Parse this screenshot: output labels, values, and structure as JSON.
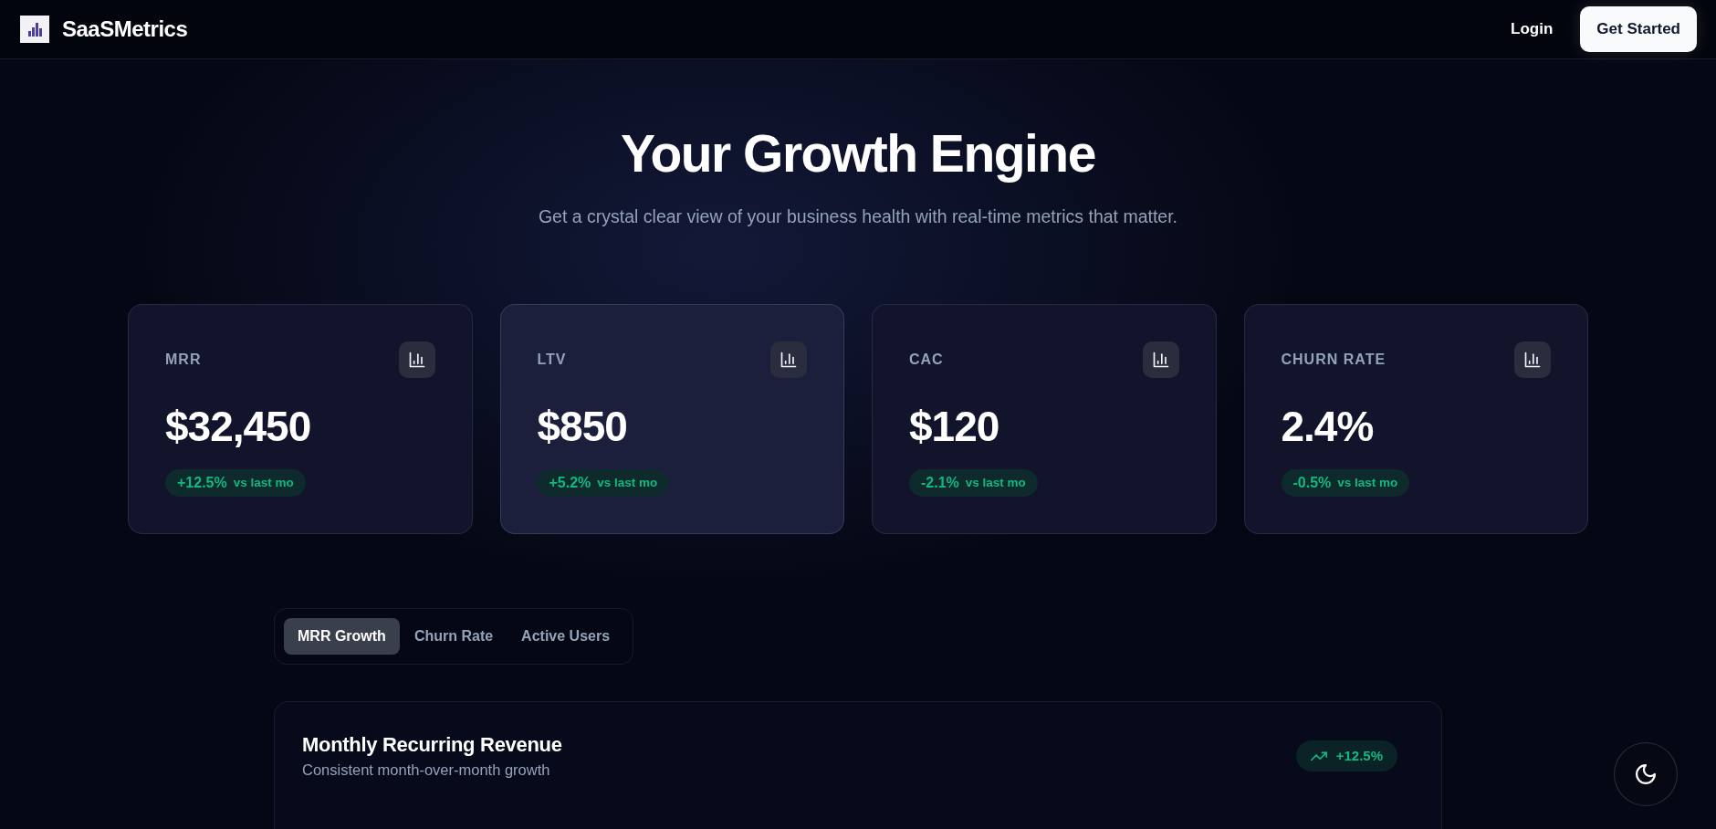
{
  "header": {
    "brand": "SaaSMetrics",
    "login": "Login",
    "cta": "Get Started"
  },
  "hero": {
    "title": "Your Growth Engine",
    "subtitle": "Get a crystal clear view of your business health with real-time metrics that matter."
  },
  "metrics": [
    {
      "label": "MRR",
      "value": "$32,450",
      "change": "+12.5%",
      "comparison": "vs last mo",
      "highlighted": false
    },
    {
      "label": "LTV",
      "value": "$850",
      "change": "+5.2%",
      "comparison": "vs last mo",
      "highlighted": true
    },
    {
      "label": "CAC",
      "value": "$120",
      "change": "-2.1%",
      "comparison": "vs last mo",
      "highlighted": false
    },
    {
      "label": "CHURN RATE",
      "value": "2.4%",
      "change": "-0.5%",
      "comparison": "vs last mo",
      "highlighted": false
    }
  ],
  "tabs": [
    {
      "label": "MRR Growth",
      "selected": true
    },
    {
      "label": "Churn Rate",
      "selected": false
    },
    {
      "label": "Active Users",
      "selected": false
    }
  ],
  "chart_panel": {
    "title": "Monthly Recurring Revenue",
    "subtitle": "Consistent month-over-month growth",
    "change": "+12.5%"
  }
}
